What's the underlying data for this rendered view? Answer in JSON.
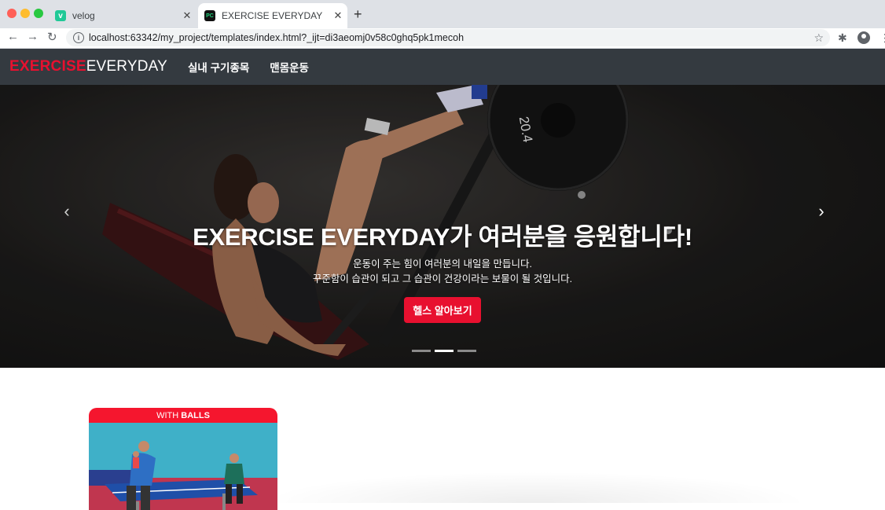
{
  "browser": {
    "tabs": [
      {
        "title": "velog",
        "favicon": "v",
        "active": false
      },
      {
        "title": "EXERCISE EVERYDAY",
        "favicon": "PC",
        "active": true
      }
    ],
    "url": "localhost:63342/my_project/templates/index.html?_ijt=di3aeomj0v58c0ghq5pk1mecoh"
  },
  "site": {
    "brand_part1": "EXERCISE",
    "brand_part2": "EVERYDAY",
    "nav": [
      "실내 구기종목",
      "맨몸운동"
    ]
  },
  "hero": {
    "heading": "EXERCISE EVERYDAY가 여러분을 응원합니다!",
    "line1": "운동이 주는 힘이 여러분의 내일을 만듭니다.",
    "line2": "꾸준함이 습관이 되고 그 습관이 건강이라는 보물이 될 것입니다.",
    "cta": "헬스 알아보기",
    "plate_text": "20.4",
    "slides": 3,
    "active_slide": 2
  },
  "card": {
    "header_prefix": "WITH",
    "header_bold": "BALLS"
  },
  "colors": {
    "brand_red": "#e8102f",
    "navbar": "#343a40"
  }
}
